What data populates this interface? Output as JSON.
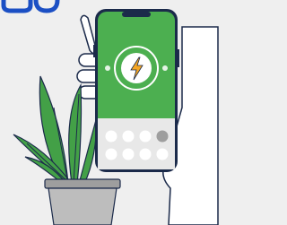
{
  "scene": {
    "header_glyphs": "",
    "icon": "lightning-bolt-icon",
    "colors": {
      "background": "#efefef",
      "screen_green": "#4caf50",
      "screen_dark_green": "#2e7d32",
      "accent_orange": "#f5a623",
      "outline_navy": "#1b2a4a",
      "header_blue": "#1b4fc4",
      "leaf_green": "#43a047",
      "pot_gray": "#9e9e9e"
    },
    "keypad": {
      "rows": 2,
      "columns": 4,
      "highlighted_key": "row-1-col-4"
    }
  }
}
